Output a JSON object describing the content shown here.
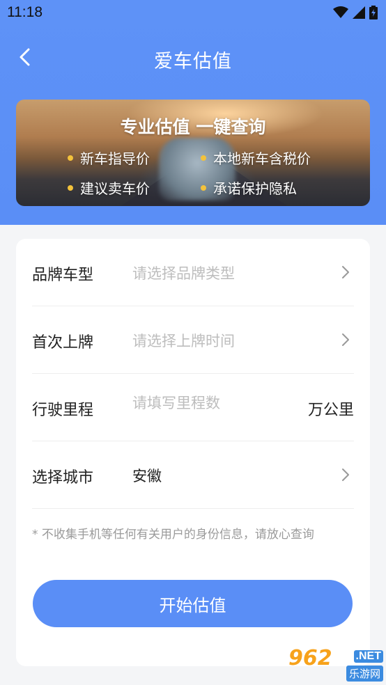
{
  "status_bar": {
    "time": "11:18"
  },
  "nav": {
    "title": "爱车估值"
  },
  "banner": {
    "title": "专业估值 一键查询",
    "features": [
      "新车指导价",
      "本地新车含税价",
      "建议卖车价",
      "承诺保护隐私"
    ]
  },
  "form": {
    "brand": {
      "label": "品牌车型",
      "placeholder": "请选择品牌类型"
    },
    "first_reg": {
      "label": "首次上牌",
      "placeholder": "请选择上牌时间"
    },
    "mileage": {
      "label": "行驶里程",
      "placeholder": "请填写里程数",
      "unit": "万公里"
    },
    "city": {
      "label": "选择城市",
      "value": "安徽"
    },
    "note": "* 不收集手机等任何有关用户的身份信息，请放心查询",
    "submit_label": "开始估值"
  },
  "watermark": {
    "main": "962",
    "net": ".NET",
    "sub": "乐游网"
  },
  "colors": {
    "primary": "#5a8ef6",
    "accent_dot": "#f3c23b"
  }
}
